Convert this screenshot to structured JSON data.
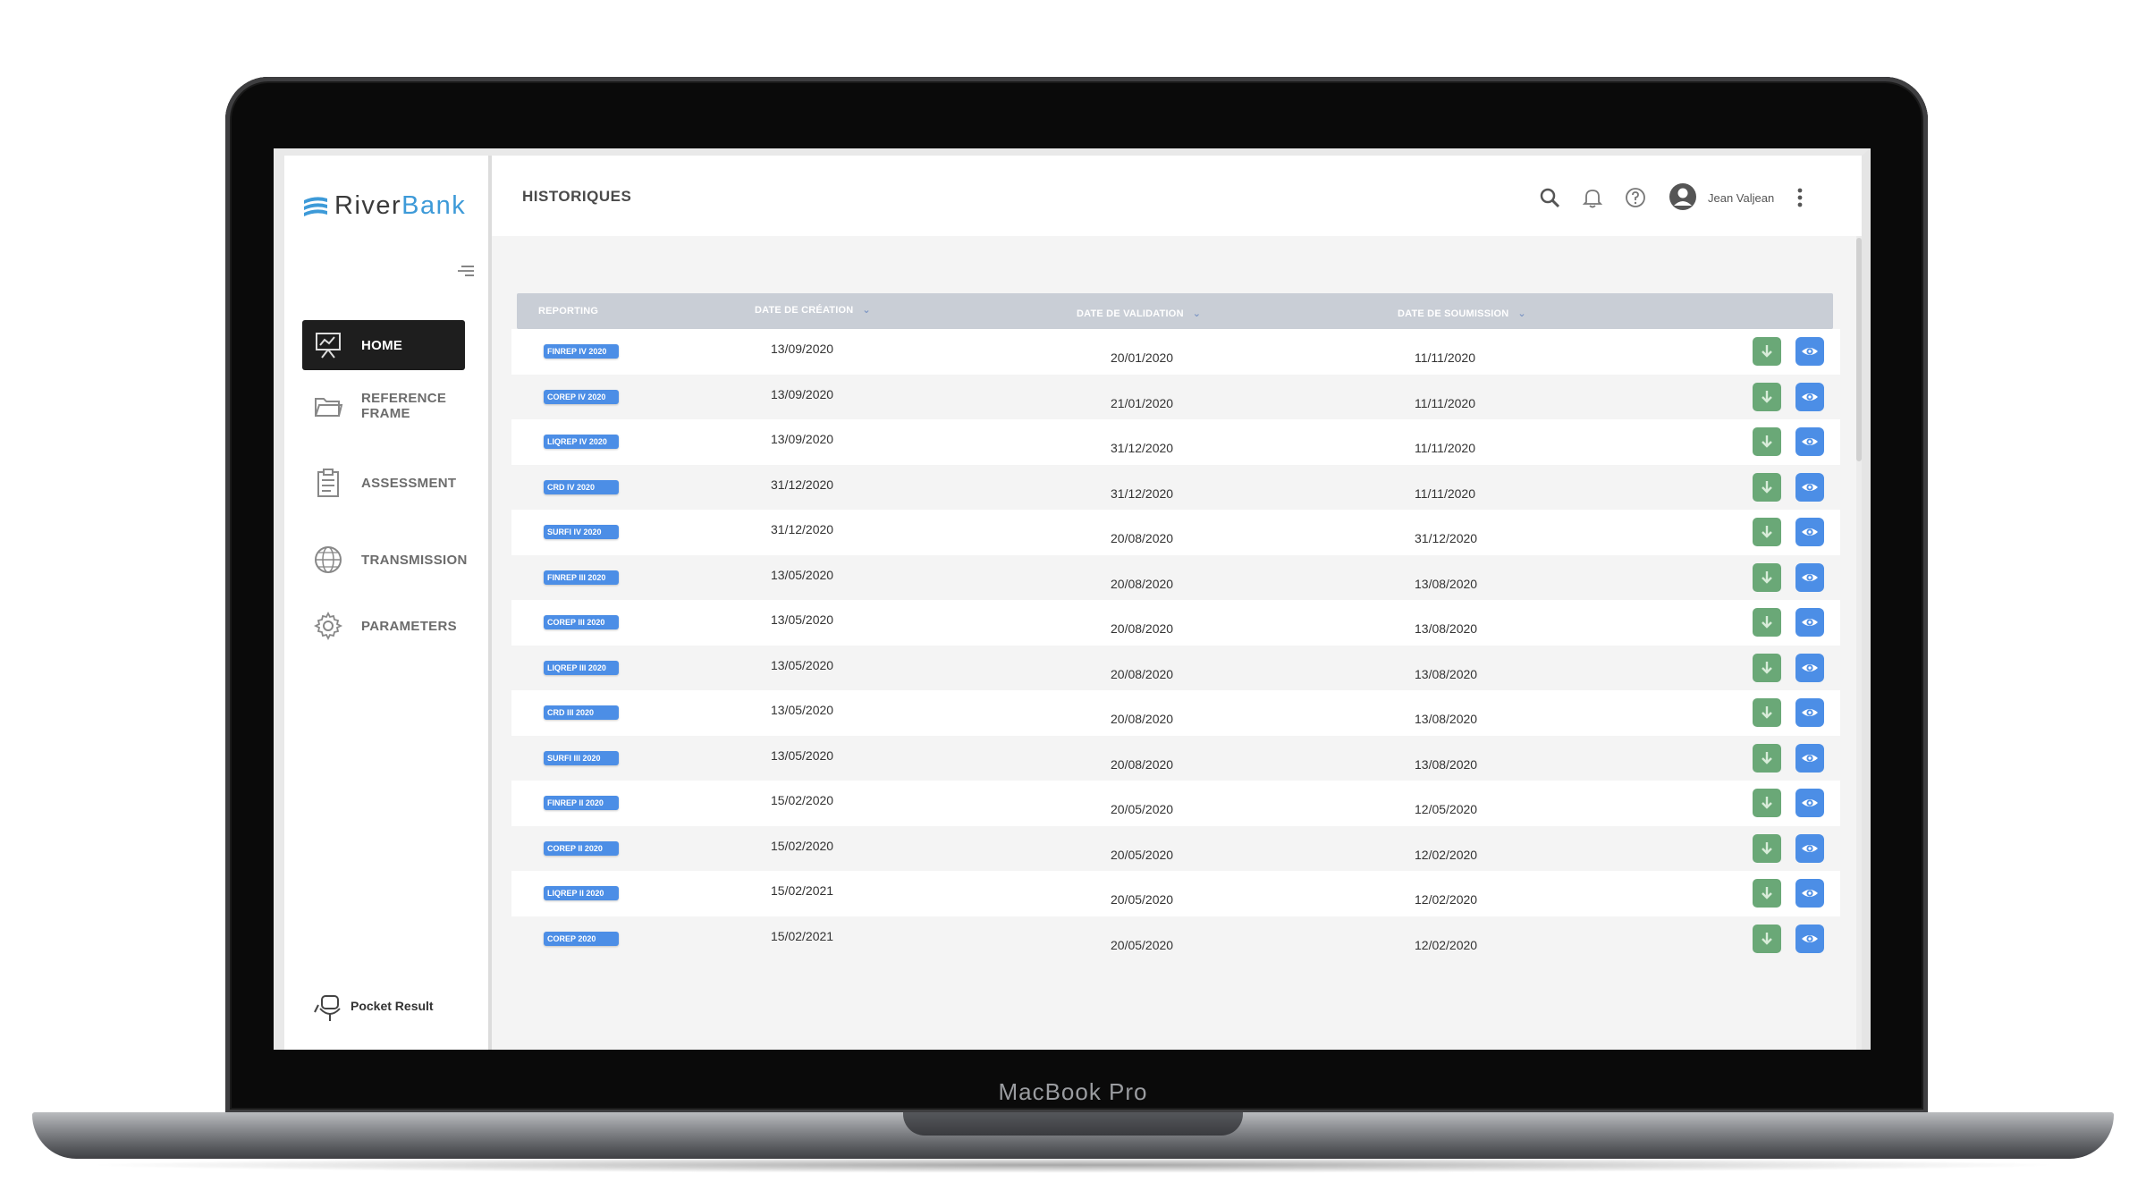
{
  "device": {
    "label": "MacBook Pro"
  },
  "app": {
    "brand": {
      "name_part1": "River",
      "name_part2": "Bank"
    },
    "page_title": "HISTORIQUES",
    "user": {
      "name": "Jean Valjean"
    }
  },
  "sidebar": {
    "items": [
      {
        "label": "HOME",
        "icon": "presentation-board-icon",
        "active": true
      },
      {
        "label": "REFERENCE\nFRAME",
        "icon": "folder-icon",
        "active": false
      },
      {
        "label": "ASSESSMENT",
        "icon": "clipboard-icon",
        "active": false
      },
      {
        "label": "TRANSMISSION",
        "icon": "globe-network-icon",
        "active": false
      },
      {
        "label": "PARAMETERS",
        "icon": "gear-icon",
        "active": false
      }
    ],
    "footer": {
      "label": "Pocket Result",
      "icon": "pocket-robot-icon"
    }
  },
  "table": {
    "headers": {
      "reporting": "REPORTING",
      "date_creation": "DATE DE CRÉATION",
      "date_validation": "DATE DE VALIDATION",
      "date_soumission": "DATE DE SOUMISSION"
    },
    "rows": [
      {
        "reporting": "FINREP IV 2020",
        "created": "13/09/2020",
        "validated": "20/01/2020",
        "submitted": "11/11/2020"
      },
      {
        "reporting": "COREP IV 2020",
        "created": "13/09/2020",
        "validated": "21/01/2020",
        "submitted": "11/11/2020"
      },
      {
        "reporting": "LIQREP IV 2020",
        "created": "13/09/2020",
        "validated": "31/12/2020",
        "submitted": "11/11/2020"
      },
      {
        "reporting": "CRD IV 2020",
        "created": "31/12/2020",
        "validated": "31/12/2020",
        "submitted": "11/11/2020"
      },
      {
        "reporting": "SURFI IV 2020",
        "created": "31/12/2020",
        "validated": "20/08/2020",
        "submitted": "31/12/2020"
      },
      {
        "reporting": "FINREP III 2020",
        "created": "13/05/2020",
        "validated": "20/08/2020",
        "submitted": "13/08/2020"
      },
      {
        "reporting": "COREP III 2020",
        "created": "13/05/2020",
        "validated": "20/08/2020",
        "submitted": "13/08/2020"
      },
      {
        "reporting": "LIQREP III 2020",
        "created": "13/05/2020",
        "validated": "20/08/2020",
        "submitted": "13/08/2020"
      },
      {
        "reporting": "CRD III 2020",
        "created": "13/05/2020",
        "validated": "20/08/2020",
        "submitted": "13/08/2020"
      },
      {
        "reporting": "SURFI III 2020",
        "created": "13/05/2020",
        "validated": "20/08/2020",
        "submitted": "13/08/2020"
      },
      {
        "reporting": "FINREP II 2020",
        "created": "15/02/2020",
        "validated": "20/05/2020",
        "submitted": "12/05/2020"
      },
      {
        "reporting": "COREP II 2020",
        "created": "15/02/2020",
        "validated": "20/05/2020",
        "submitted": "12/02/2020"
      },
      {
        "reporting": "LIQREP II 2020",
        "created": "15/02/2021",
        "validated": "20/05/2020",
        "submitted": "12/02/2020"
      },
      {
        "reporting": "COREP 2020",
        "created": "15/02/2021",
        "validated": "20/05/2020",
        "submitted": "12/02/2020"
      }
    ],
    "row_actions": [
      "download-icon",
      "eye-icon"
    ]
  },
  "colors": {
    "badge": "#4c8ee6",
    "download_button": "#6aa877",
    "view_button": "#4c8ee6",
    "header_bg": "#c9ced6",
    "active_nav": "#1e1e1e",
    "brand_accent": "#3d9ad8"
  }
}
